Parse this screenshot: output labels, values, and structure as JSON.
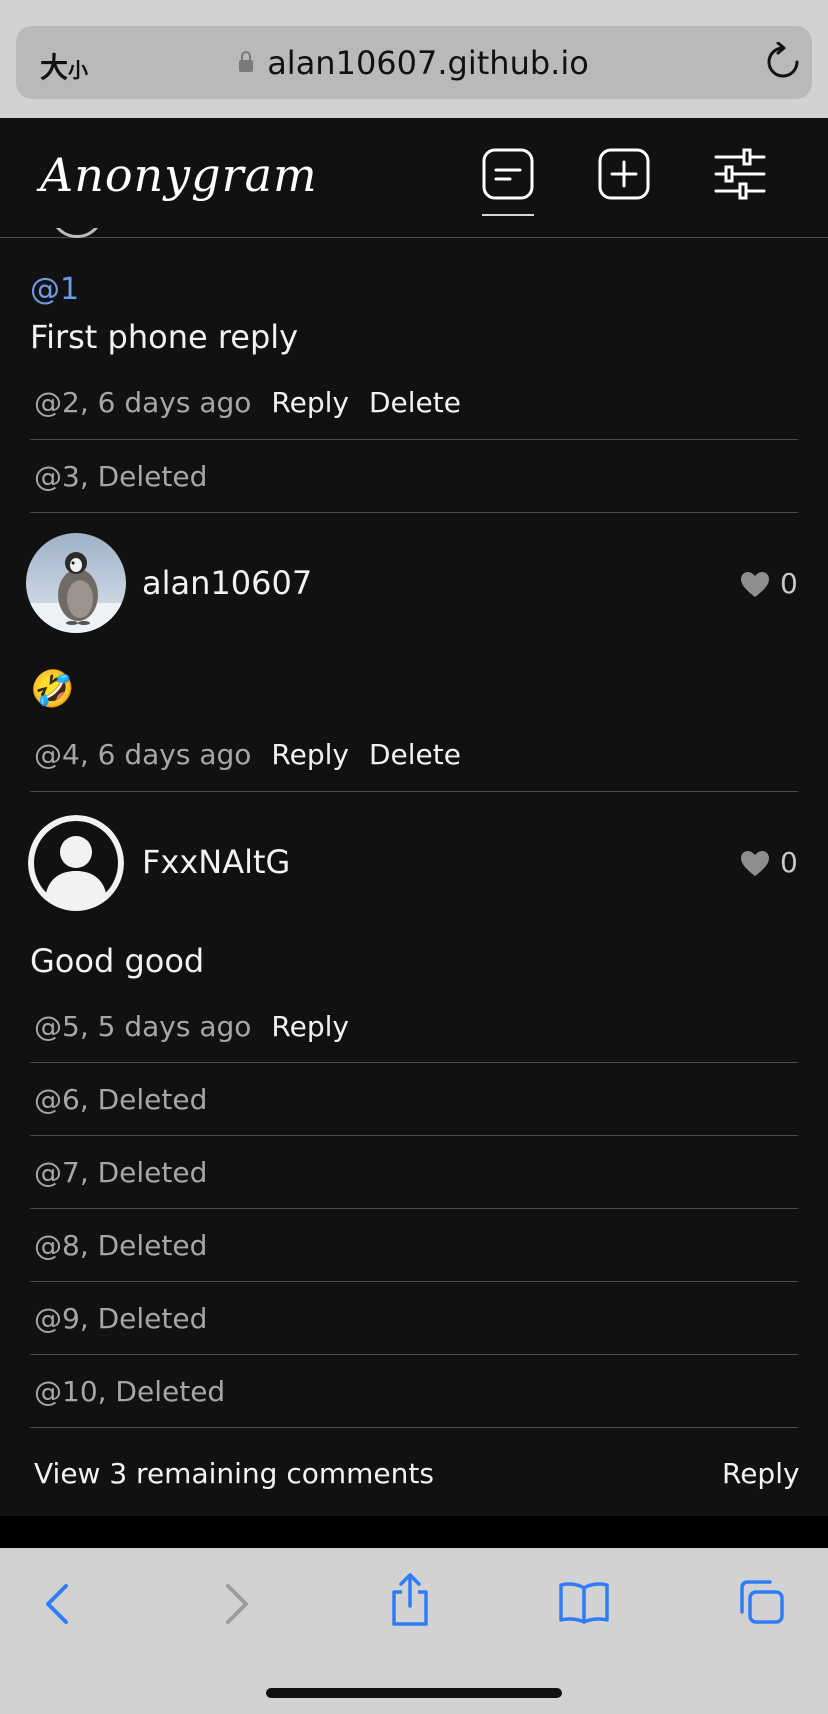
{
  "browser": {
    "text_size_label_big": "大",
    "text_size_label_small": "小",
    "url": "alan10607.github.io"
  },
  "app": {
    "logo": "Anonygram"
  },
  "comments": {
    "reply1": {
      "mention": "@1",
      "text": "First phone reply",
      "meta": "@2, 6 days ago",
      "reply_label": "Reply",
      "delete_label": "Delete"
    },
    "deleted3": "@3, Deleted",
    "reply4": {
      "username": "alan10607",
      "likes": "0",
      "text": "🤣",
      "meta": "@4, 6 days ago",
      "reply_label": "Reply",
      "delete_label": "Delete"
    },
    "reply5": {
      "username": "FxxNAltG",
      "likes": "0",
      "text": "Good good",
      "meta": "@5, 5 days ago",
      "reply_label": "Reply"
    },
    "deleted": [
      "@6, Deleted",
      "@7, Deleted",
      "@8, Deleted",
      "@9, Deleted",
      "@10, Deleted"
    ],
    "view_remaining": "View 3 remaining comments",
    "footer_reply": "Reply"
  },
  "colors": {
    "background": "#111111",
    "mention": "#6e9be8",
    "safari_blue": "#2f7cf6"
  }
}
